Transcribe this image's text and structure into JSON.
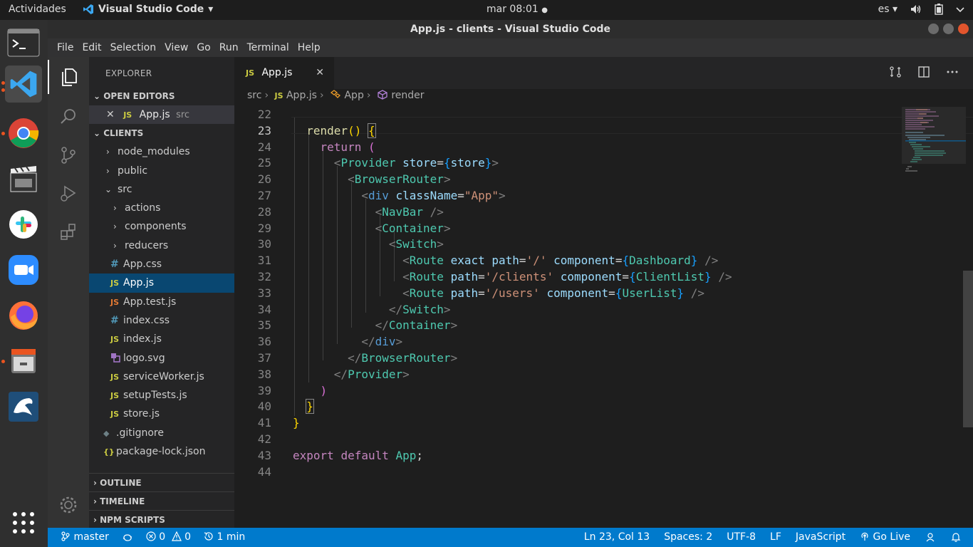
{
  "topbar": {
    "activities": "Actividades",
    "app_name": "Visual Studio Code",
    "app_menu_arrow": "▾",
    "clock": "mar 08:01",
    "clock_dot": "●",
    "lang": "es",
    "lang_arrow": "▾"
  },
  "window": {
    "title": "App.js - clients - Visual Studio Code"
  },
  "menubar": [
    "File",
    "Edit",
    "Selection",
    "View",
    "Go",
    "Run",
    "Terminal",
    "Help"
  ],
  "sidebar": {
    "title": "EXPLORER",
    "open_editors_header": "OPEN EDITORS",
    "open_editor": {
      "icon": "JS",
      "name": "App.js",
      "folder": "src"
    },
    "workspace_header": "CLIENTS",
    "tree": [
      {
        "name": "node_modules",
        "type": "folder"
      },
      {
        "name": "public",
        "type": "folder"
      },
      {
        "name": "src",
        "type": "folder-open"
      },
      {
        "name": "actions",
        "type": "folder"
      },
      {
        "name": "components",
        "type": "folder"
      },
      {
        "name": "reducers",
        "type": "folder"
      },
      {
        "name": "App.css",
        "icon": "#"
      },
      {
        "name": "App.js",
        "icon": "JS"
      },
      {
        "name": "App.test.js",
        "icon": "JS"
      },
      {
        "name": "index.css",
        "icon": "#"
      },
      {
        "name": "index.js",
        "icon": "JS"
      },
      {
        "name": "logo.svg",
        "icon": "svg"
      },
      {
        "name": "serviceWorker.js",
        "icon": "JS"
      },
      {
        "name": "setupTests.js",
        "icon": "JS"
      },
      {
        "name": "store.js",
        "icon": "JS"
      },
      {
        "name": ".gitignore",
        "icon": "◆"
      },
      {
        "name": "package-lock.json",
        "icon": "{}"
      }
    ],
    "outline_header": "OUTLINE",
    "timeline_header": "TIMELINE",
    "npm_header": "NPM SCRIPTS"
  },
  "editor": {
    "tab": {
      "icon": "JS",
      "label": "App.js",
      "close": "✕"
    },
    "breadcrumb": {
      "folder": "src",
      "file_icon": "JS",
      "file": "App.js",
      "class": "App",
      "method": "render"
    },
    "line_numbers": [
      "22",
      "23",
      "24",
      "25",
      "26",
      "27",
      "28",
      "29",
      "30",
      "31",
      "32",
      "33",
      "34",
      "35",
      "36",
      "37",
      "38",
      "39",
      "40",
      "41",
      "42",
      "43",
      "44"
    ],
    "lines": {
      "l23_fn": "render",
      "l24_kw": "return",
      "l25_tag": "Provider",
      "l25_attr": "store",
      "l25_val": "store",
      "l26_tag": "BrowserRouter",
      "l27_tag": "div",
      "l27_attr": "className",
      "l27_str": "\"App\"",
      "l28_tag": "NavBar",
      "l29_tag": "Container",
      "l30_tag": "Switch",
      "l31_tag": "Route",
      "l31_a1": "exact",
      "l31_a2": "path",
      "l31_s": "'/'",
      "l31_a3": "component",
      "l31_v": "Dashboard",
      "l32_tag": "Route",
      "l32_a2": "path",
      "l32_s": "'/clients'",
      "l32_a3": "component",
      "l32_v": "ClientList",
      "l33_tag": "Route",
      "l33_a2": "path",
      "l33_s": "'/users'",
      "l33_a3": "component",
      "l33_v": "UserList",
      "l34_tag": "Switch",
      "l35_tag": "Container",
      "l36_tag": "div",
      "l37_tag": "BrowserRouter",
      "l38_tag": "Provider",
      "l43_kw1": "export",
      "l43_kw2": "default",
      "l43_id": "App"
    }
  },
  "statusbar": {
    "branch": "master",
    "problems_errors": "0",
    "problems_warnings": "0",
    "timer": "1 min",
    "position": "Ln 23, Col 13",
    "indent": "Spaces: 2",
    "encoding": "UTF-8",
    "eol": "LF",
    "language": "JavaScript",
    "golive": "Go Live"
  }
}
